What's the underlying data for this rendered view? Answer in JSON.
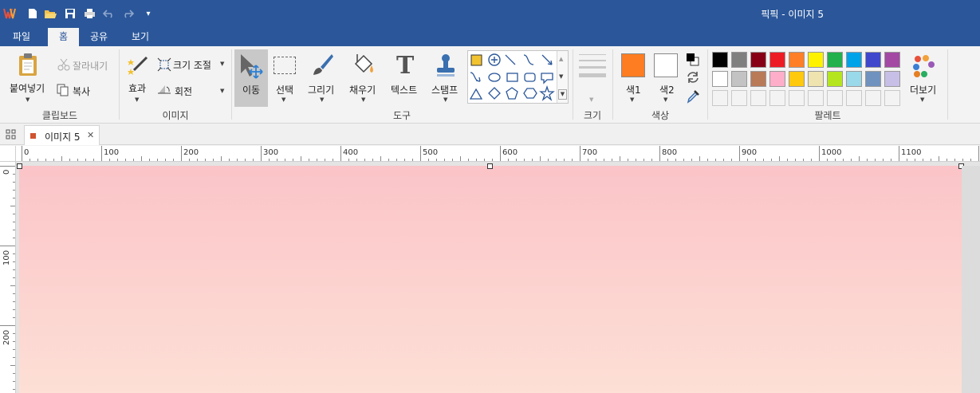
{
  "window": {
    "title": "픽픽 - 이미지 5"
  },
  "quick_access": {
    "more_symbol": "▾"
  },
  "tabs": [
    {
      "label": "파일"
    },
    {
      "label": "홈"
    },
    {
      "label": "공유"
    },
    {
      "label": "보기"
    }
  ],
  "ribbon": {
    "clipboard": {
      "paste": "붙여넣기",
      "cut": "잘라내기",
      "copy": "복사",
      "group": "클립보드"
    },
    "image": {
      "effects": "효과",
      "resize": "크기 조절",
      "rotate": "회전",
      "group": "이미지"
    },
    "tools": {
      "move": "이동",
      "select": "선택",
      "draw": "그리기",
      "fill": "채우기",
      "text": "텍스트",
      "stamp": "스탬프",
      "group": "도구"
    },
    "size": {
      "group": "크기"
    },
    "color": {
      "color1": "색1",
      "color2": "색2",
      "group": "색상",
      "color1_value": "#fe7d22",
      "color2_value": "#ffffff"
    },
    "palette": {
      "more": "더보기",
      "group": "팔레트",
      "row1": [
        "#000000",
        "#7f7f7f",
        "#880015",
        "#ed1c24",
        "#ff7f27",
        "#fff200",
        "#22b14c",
        "#00a2e8",
        "#3f48cc",
        "#a349a4"
      ],
      "row2": [
        "#ffffff",
        "#c3c3c3",
        "#b97a57",
        "#ffaec9",
        "#ffc90e",
        "#efe4b0",
        "#b5e61d",
        "#99d9ea",
        "#7092be",
        "#c8bfe7"
      ]
    }
  },
  "document": {
    "tab_label": "이미지 5",
    "close_symbol": "✕"
  },
  "ruler": {
    "h_labels": [
      "0",
      "100",
      "200",
      "300",
      "400",
      "500",
      "600",
      "700",
      "800",
      "900",
      "1000",
      "1100"
    ],
    "v_labels": [
      "0",
      "100",
      "200"
    ]
  },
  "canvas": {
    "gradient_top": "#fbc4c8",
    "gradient_bottom": "#fde0d6"
  }
}
